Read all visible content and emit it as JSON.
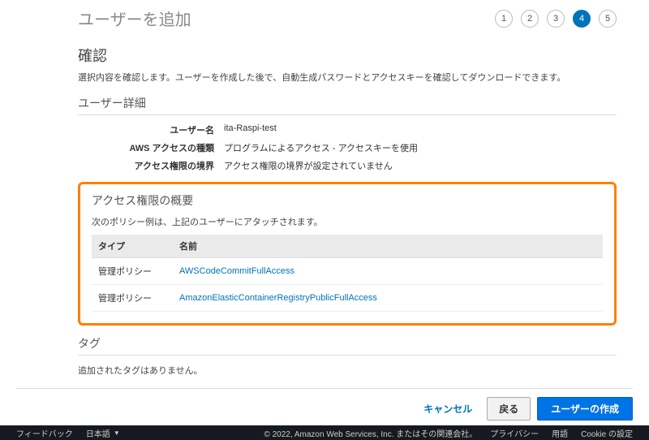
{
  "header": {
    "title": "ユーザーを追加",
    "steps": [
      "1",
      "2",
      "3",
      "4",
      "5"
    ],
    "active_step_index": 3
  },
  "confirm": {
    "title": "確認",
    "desc": "選択内容を確認します。ユーザーを作成した後で、自動生成パスワードとアクセスキーを確認してダウンロードできます。"
  },
  "user_details": {
    "title": "ユーザー詳細",
    "rows": [
      {
        "label": "ユーザー名",
        "value": "ita-Raspi-test"
      },
      {
        "label": "AWS アクセスの種類",
        "value": "プログラムによるアクセス - アクセスキーを使用"
      },
      {
        "label": "アクセス権限の境界",
        "value": "アクセス権限の境界が設定されていません"
      }
    ]
  },
  "permissions": {
    "title": "アクセス権限の概要",
    "desc": "次のポリシー例は、上記のユーザーにアタッチされます。",
    "columns": {
      "type": "タイプ",
      "name": "名前"
    },
    "rows": [
      {
        "type": "管理ポリシー",
        "name": "AWSCodeCommitFullAccess"
      },
      {
        "type": "管理ポリシー",
        "name": "AmazonElasticContainerRegistryPublicFullAccess"
      }
    ]
  },
  "tags": {
    "title": "タグ",
    "empty": "追加されたタグはありません。"
  },
  "buttons": {
    "cancel": "キャンセル",
    "back": "戻る",
    "create": "ユーザーの作成"
  },
  "footer": {
    "feedback": "フィードバック",
    "language": "日本語",
    "copyright": "© 2022, Amazon Web Services, Inc. またはその関連会社。",
    "privacy": "プライバシー",
    "terms": "用語",
    "cookie": "Cookie の設定"
  }
}
